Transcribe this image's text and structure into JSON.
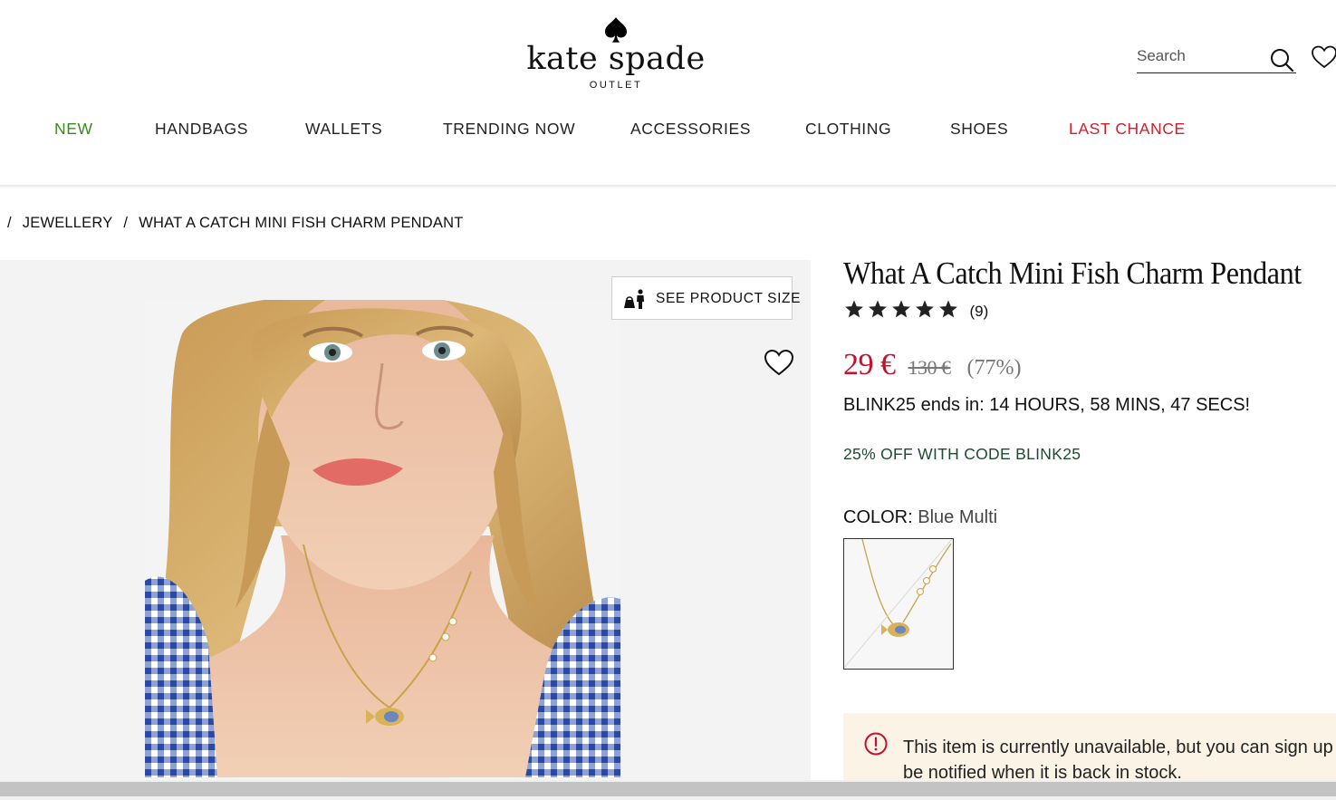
{
  "header": {
    "brand": "kate spade",
    "sub_brand": "OUTLET",
    "search_placeholder": "Search"
  },
  "nav": {
    "items": [
      {
        "label": "NEW",
        "color": "#3a8a20"
      },
      {
        "label": "HANDBAGS"
      },
      {
        "label": "WALLETS"
      },
      {
        "label": "TRENDING NOW"
      },
      {
        "label": "ACCESSORIES"
      },
      {
        "label": "CLOTHING"
      },
      {
        "label": "SHOES"
      },
      {
        "label": "LAST CHANCE",
        "color": "#d0202a"
      }
    ]
  },
  "breadcrumb": {
    "separator": "/",
    "items": [
      "JEWELLERY",
      "WHAT A CATCH MINI FISH CHARM PENDANT"
    ]
  },
  "gallery": {
    "size_button_label": "SEE PRODUCT SIZE"
  },
  "product": {
    "title": "What A Catch Mini Fish Charm Pendant",
    "rating_stars": 5,
    "review_count": "(9)",
    "price_sale": "29 €",
    "price_original": "130 €",
    "discount": "(77%)",
    "promo_timer": "BLINK25 ends in: 14 HOURS, 58 MINS, 47 SECS!",
    "promo_code": "25% OFF WITH CODE BLINK25",
    "color_label": "COLOR:",
    "color_value": "Blue Multi",
    "availability_message": "This item is currently unavailable, but you can sign up to be notified when it is back in stock."
  },
  "colors": {
    "sale_red": "#c8102e",
    "new_green": "#3a8a20",
    "notice_bg": "#faf3e6"
  }
}
